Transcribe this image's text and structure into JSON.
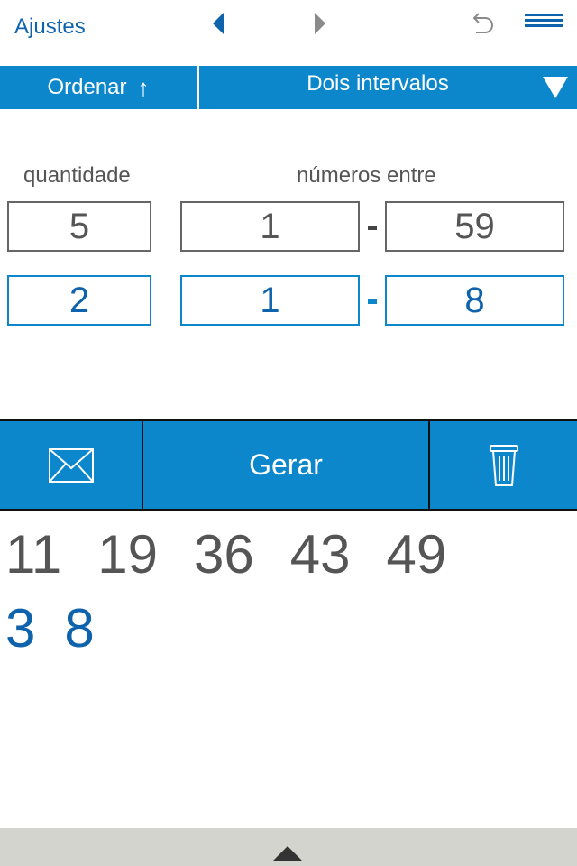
{
  "colors": {
    "accent_blue": "#0d87cc",
    "link_blue": "#0f63ad",
    "gray_text": "#555555",
    "bottom_bar": "#d4d4ce"
  },
  "top_nav": {
    "settings_label": "Ajustes",
    "icons": [
      "arrow-left-icon",
      "arrow-right-icon",
      "undo-icon",
      "menu-icon"
    ]
  },
  "toolbar": {
    "sort_label": "Ordenar",
    "sort_arrow": "↑",
    "mode_label": "Dois intervalos",
    "mode_icon": "dropdown-triangle-icon"
  },
  "form": {
    "quantity_label": "quantidade",
    "range_label": "números entre",
    "main": {
      "quantity": "5",
      "from": "1",
      "to": "59"
    },
    "extra": {
      "quantity": "2",
      "from": "1",
      "to": "8"
    }
  },
  "actions": {
    "generate_label": "Gerar",
    "share_icon": "envelope-icon",
    "clear_icon": "trash-icon"
  },
  "results": {
    "main_numbers": [
      "11",
      "19",
      "36",
      "43",
      "49"
    ],
    "extra_numbers": [
      "3",
      "8"
    ]
  },
  "bottom_bar": {
    "icon": "expand-up-triangle-icon"
  }
}
